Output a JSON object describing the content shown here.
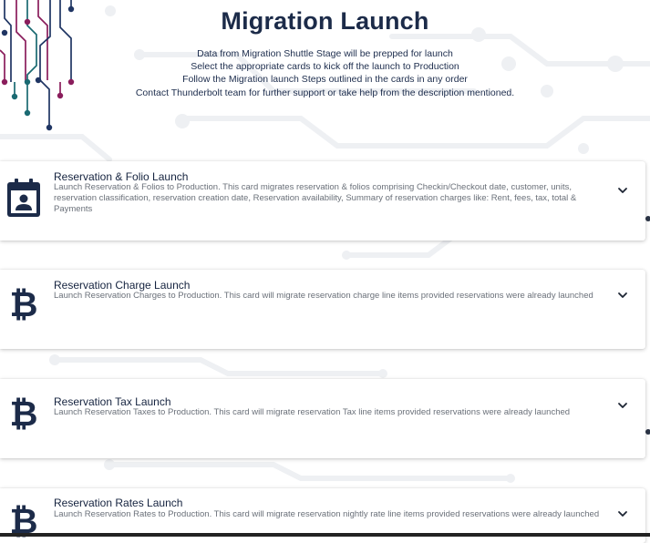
{
  "page": {
    "title": "Migration Launch",
    "subtitle_lines": [
      "Data from Migration Shuttle Stage will be prepped for launch",
      "Select the appropriate cards to kick off the launch to Production",
      "Follow the Migration launch Steps outlined in the cards in any order",
      "Contact Thunderbolt team for further support or take help from the description mentioned."
    ]
  },
  "cards": [
    {
      "title": "Reservation & Folio Launch",
      "description": "Launch Reservation & Folios to Production. This card migrates reservation & folios comprising Checkin/Checkout date, customer, units, reservation classification, reservation creation date, Reservation availability, Summary of reservation charges like: Rent, fees, tax, total & Payments",
      "icon": "calendar-user-icon"
    },
    {
      "title": "Reservation Charge Launch",
      "description": "Launch Reservation Charges to Production. This card will migrate reservation charge line items provided reservations were already launched",
      "icon": "bitcoin-icon"
    },
    {
      "title": "Reservation Tax Launch",
      "description": "Launch Reservation Taxes to Production. This card will migrate reservation Tax line items provided reservations were already launched",
      "icon": "bitcoin-icon"
    },
    {
      "title": "Reservation Rates Launch",
      "description": "Launch Reservation Rates to Production. This card will migrate reservation nightly rate line items provided reservations were already launched",
      "icon": "bitcoin-icon"
    }
  ],
  "colors": {
    "title": "#1c2b49",
    "card_title": "#15233f",
    "description": "#6a7079",
    "circuit_navy": "#1f3563",
    "circuit_magenta": "#8a1d5c",
    "circuit_teal": "#1a6a72"
  }
}
